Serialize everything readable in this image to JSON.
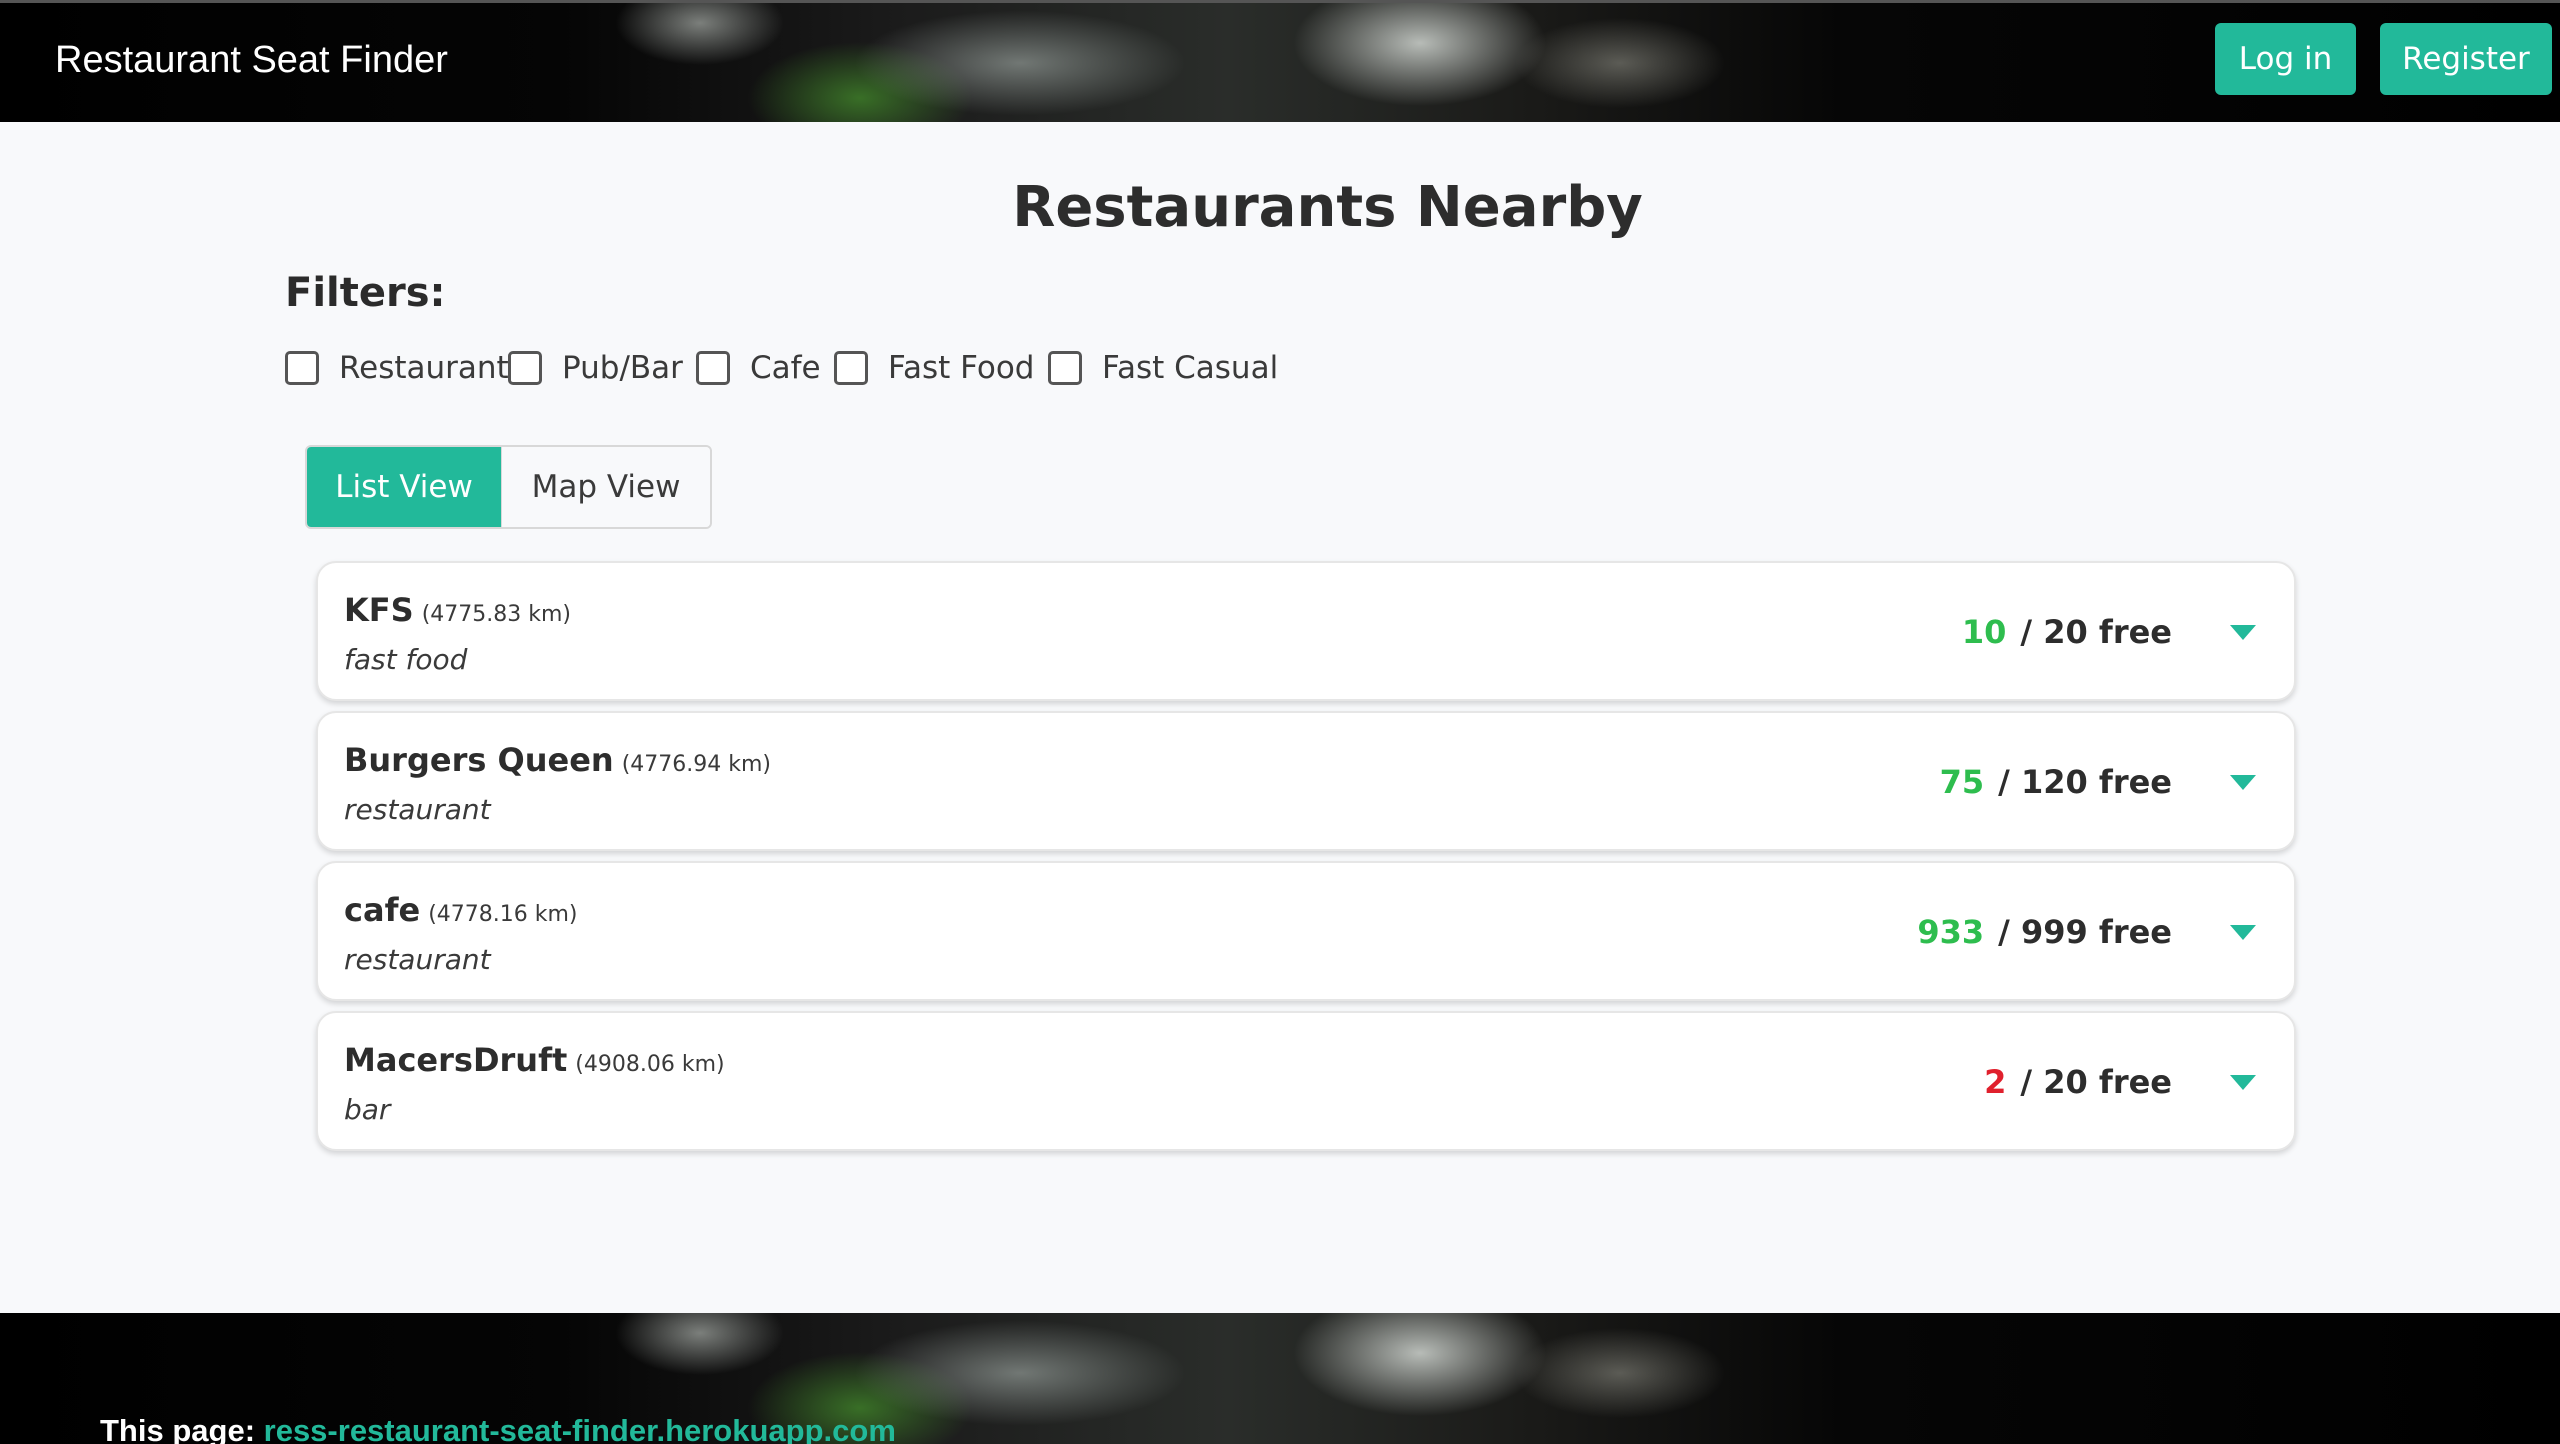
{
  "header": {
    "brand": "Restaurant Seat Finder",
    "login_label": "Log in",
    "register_label": "Register"
  },
  "main": {
    "title": "Restaurants Nearby",
    "filters_label": "Filters:",
    "filters": [
      {
        "label": "Restaurant",
        "checked": false
      },
      {
        "label": "Pub/Bar",
        "checked": false
      },
      {
        "label": "Cafe",
        "checked": false
      },
      {
        "label": "Fast Food",
        "checked": false
      },
      {
        "label": "Fast Casual",
        "checked": false
      }
    ],
    "views": {
      "list_label": "List View",
      "map_label": "Map View",
      "active": "List View"
    },
    "restaurants": [
      {
        "name": "KFS",
        "distance": "(4775.83 km)",
        "type": "fast food",
        "free": "10",
        "total": "/ 20 free",
        "free_color": "#2ebd4e"
      },
      {
        "name": "Burgers Queen",
        "distance": "(4776.94 km)",
        "type": "restaurant",
        "free": "75",
        "total": "/ 120 free",
        "free_color": "#2ebd4e"
      },
      {
        "name": "cafe",
        "distance": "(4778.16 km)",
        "type": "restaurant",
        "free": "933",
        "total": "/ 999 free",
        "free_color": "#2ebd4e"
      },
      {
        "name": "MacersDruft",
        "distance": "(4908.06 km)",
        "type": "bar",
        "free": "2",
        "total": "/ 20 free",
        "free_color": "#e0202d"
      }
    ]
  },
  "footer": {
    "label": "This page:",
    "link": "ress-restaurant-seat-finder.herokuapp.com"
  },
  "colors": {
    "accent": "#22b99a",
    "available": "#2ebd4e",
    "scarce": "#e0202d"
  }
}
